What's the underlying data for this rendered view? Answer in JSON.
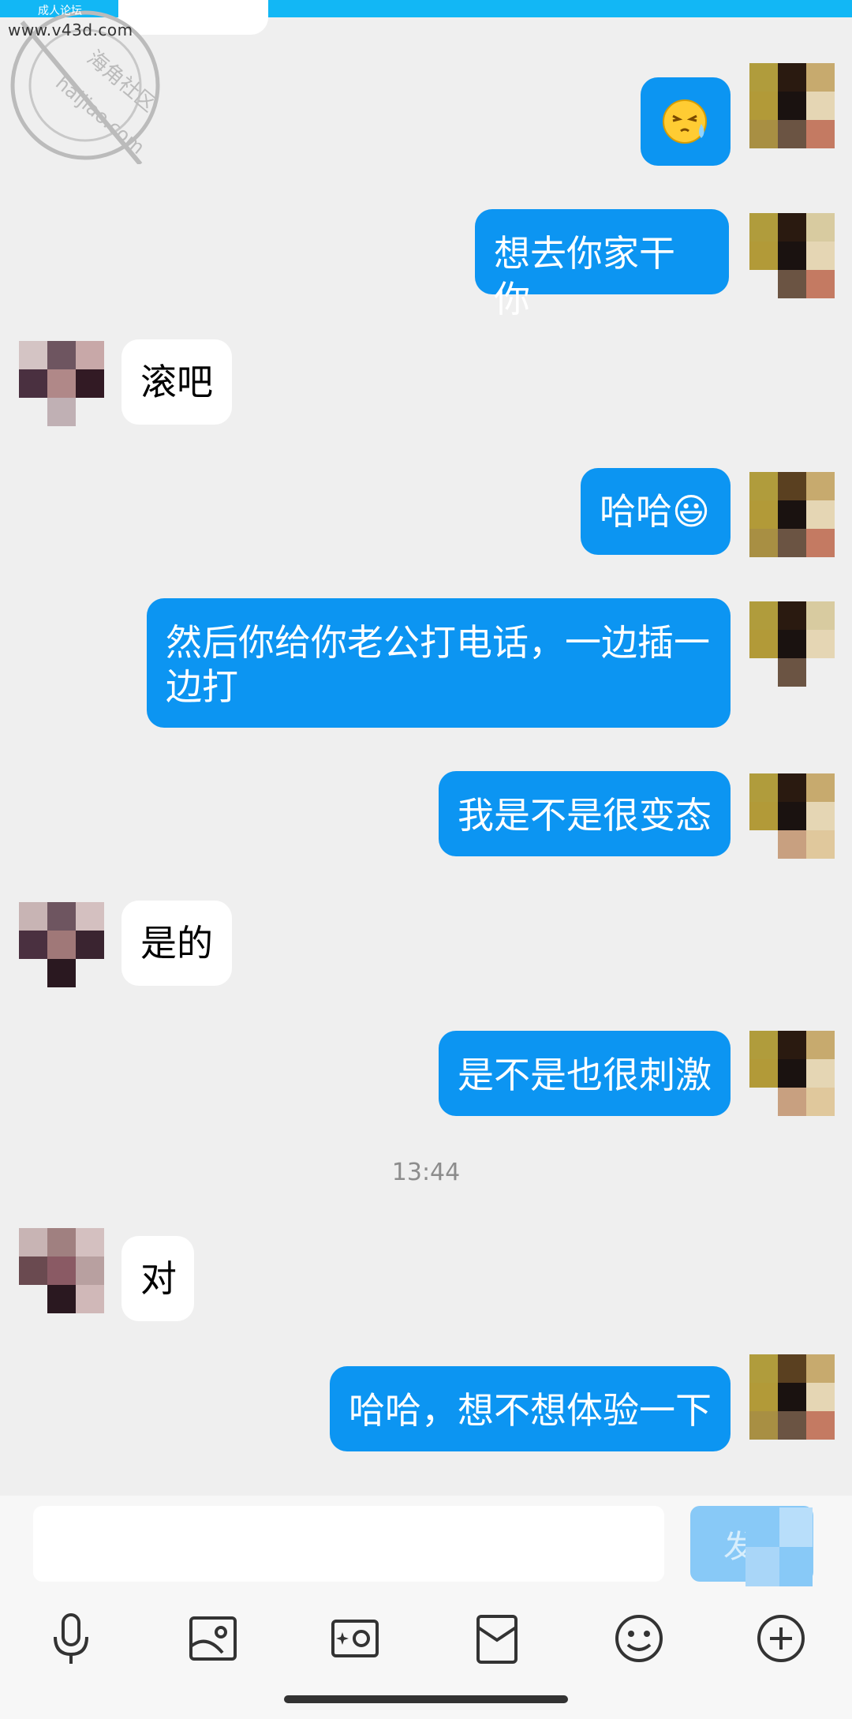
{
  "watermark": {
    "top_text": "成人论坛",
    "url": "www.v43d.com",
    "seal_line1": "海角社区",
    "seal_line2": "haijiao.com"
  },
  "messages": [
    {
      "from": "me",
      "text": "😣"
    },
    {
      "from": "me",
      "text": "想去你家干你"
    },
    {
      "from": "them",
      "text": "滚吧"
    },
    {
      "from": "me",
      "text": "哈哈😃"
    },
    {
      "from": "me",
      "text": "然后你给你老公打电话，一边插一",
      "text2": "边打"
    },
    {
      "from": "me",
      "text": "我是不是很变态"
    },
    {
      "from": "them",
      "text": "是的"
    },
    {
      "from": "me",
      "text": "是不是也很刺激"
    },
    {
      "from": "them",
      "text": "对"
    },
    {
      "from": "me",
      "text": "哈哈，想不想体验一下"
    }
  ],
  "timestamp": "13:44",
  "input": {
    "placeholder": "",
    "send_label": "发"
  },
  "toolbar": [
    "microphone-icon",
    "image-icon",
    "camera-icon",
    "red-packet-icon",
    "emoji-icon",
    "plus-icon"
  ],
  "colors": {
    "my_bubble": "#0c95f2",
    "their_bubble": "#ffffff",
    "background": "#efefef",
    "top_accent": "#12b7f5"
  }
}
